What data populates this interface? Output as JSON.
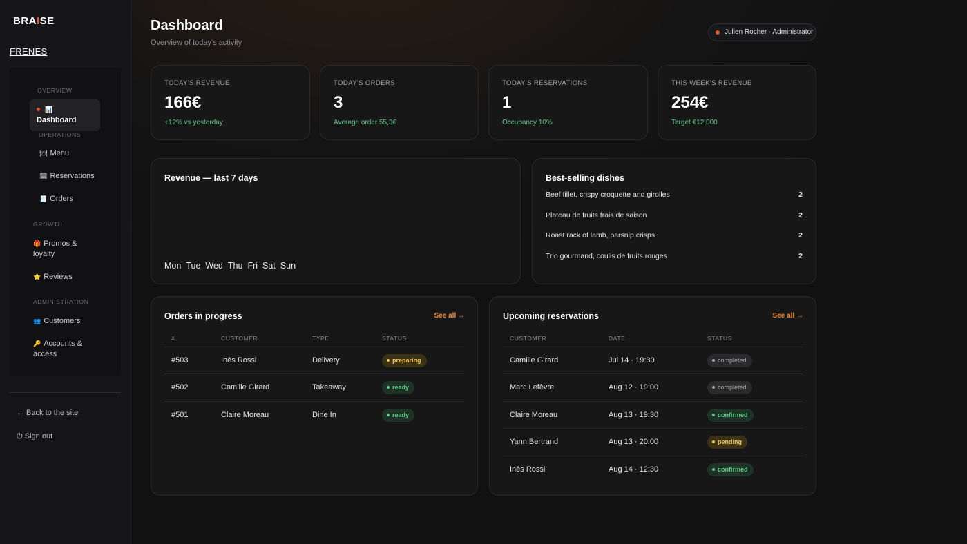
{
  "brand": {
    "logo_pre": "BRA",
    "logo_accent": "I",
    "logo_post": "SE",
    "restaurant": "FRENES"
  },
  "sidebar": {
    "sections": {
      "overview": "OVERVIEW",
      "operations": "OPERATIONS",
      "growth": "GROWTH",
      "administration": "ADMINISTRATION"
    },
    "items": {
      "dashboard": {
        "icon": "📊",
        "label": "Dashboard"
      },
      "menu": {
        "icon": "🍽",
        "label": "Menu"
      },
      "reservations": {
        "icon": "🗓",
        "label": "Reservations"
      },
      "orders": {
        "icon": "🧾",
        "label": "Orders"
      },
      "promos": {
        "icon": "🎁",
        "label": "Promos & loyalty"
      },
      "reviews": {
        "icon": "⭐",
        "label": "Reviews"
      },
      "customers": {
        "icon": "👥",
        "label": "Customers"
      },
      "accounts": {
        "icon": "🔑",
        "label": "Accounts & access"
      }
    },
    "back_link": "← Back to the site",
    "sign_out": "⏻ Sign out"
  },
  "header": {
    "title": "Dashboard",
    "subtitle": "Overview of today's activity",
    "user": "Julien Rocher · Administrator"
  },
  "kpis": [
    {
      "label": "TODAY'S REVENUE",
      "value": "166€",
      "sub": "+12% vs yesterday"
    },
    {
      "label": "TODAY'S ORDERS",
      "value": "3",
      "sub": "Average order 55,3€"
    },
    {
      "label": "TODAY'S RESERVATIONS",
      "value": "1",
      "sub": "Occupancy 10%"
    },
    {
      "label": "THIS WEEK'S REVENUE",
      "value": "254€",
      "sub": "Target €12,000"
    }
  ],
  "revenue_chart": {
    "title": "Revenue — last 7 days",
    "days": [
      "Mon",
      "Tue",
      "Wed",
      "Thu",
      "Fri",
      "Sat",
      "Sun"
    ]
  },
  "best_selling": {
    "title": "Best-selling dishes",
    "items": [
      {
        "name": "Beef fillet, crispy croquette and girolles",
        "count": "2"
      },
      {
        "name": "Plateau de fruits frais de saison",
        "count": "2"
      },
      {
        "name": "Roast rack of lamb, parsnip crisps",
        "count": "2"
      },
      {
        "name": "Trio gourmand, coulis de fruits rouges",
        "count": "2"
      }
    ]
  },
  "orders": {
    "title": "Orders in progress",
    "see_all": "See all →",
    "columns": [
      "#",
      "CUSTOMER",
      "TYPE",
      "STATUS"
    ],
    "rows": [
      {
        "id": "#503",
        "customer": "Inès Rossi",
        "type": "Delivery",
        "status": "preparing"
      },
      {
        "id": "#502",
        "customer": "Camille Girard",
        "type": "Takeaway",
        "status": "ready"
      },
      {
        "id": "#501",
        "customer": "Claire Moreau",
        "type": "Dine In",
        "status": "ready"
      }
    ]
  },
  "reservations": {
    "title": "Upcoming reservations",
    "see_all": "See all →",
    "columns": [
      "CUSTOMER",
      "DATE",
      "STATUS"
    ],
    "rows": [
      {
        "customer": "Camille Girard",
        "date": "Jul 14 · 19:30",
        "status": "completed"
      },
      {
        "customer": "Marc Lefèvre",
        "date": "Aug 12 · 19:00",
        "status": "completed"
      },
      {
        "customer": "Claire Moreau",
        "date": "Aug 13 · 19:30",
        "status": "confirmed"
      },
      {
        "customer": "Yann Bertrand",
        "date": "Aug 13 · 20:00",
        "status": "pending"
      },
      {
        "customer": "Inès Rossi",
        "date": "Aug 14 · 12:30",
        "status": "confirmed"
      }
    ]
  },
  "colors": {
    "accent": "#e8512a",
    "link": "#f08a2e",
    "positive": "#63c98a",
    "warning": "#f3c64f"
  }
}
